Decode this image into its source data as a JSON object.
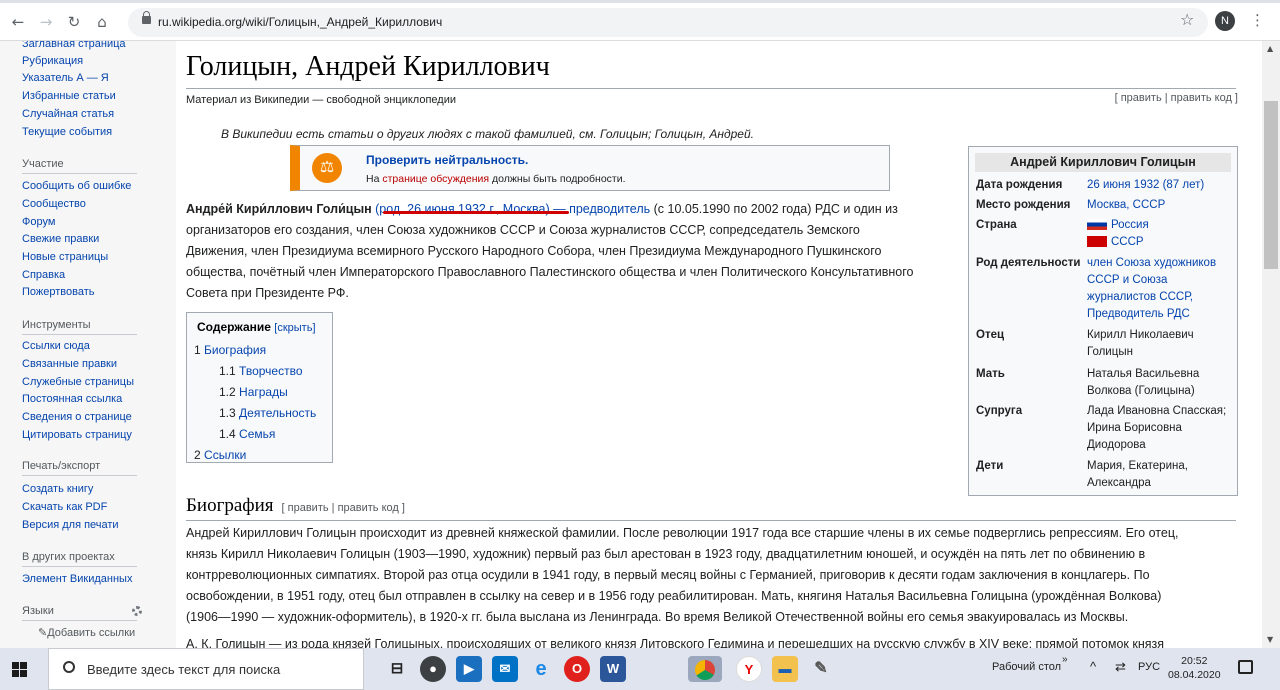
{
  "browser": {
    "url": "ru.wikipedia.org/wiki/Голицын,_Андрей_Кириллович",
    "avatar_letter": "N"
  },
  "sidebar": {
    "nav": [
      "Заглавная страница",
      "Рубрикация",
      "Указатель А — Я",
      "Избранные статьи",
      "Случайная статья",
      "Текущие события"
    ],
    "participation_header": "Участие",
    "participation": [
      "Сообщить об ошибке",
      "Сообщество",
      "Форум",
      "Свежие правки",
      "Новые страницы",
      "Справка",
      "Пожертвовать"
    ],
    "tools_header": "Инструменты",
    "tools": [
      "Ссылки сюда",
      "Связанные правки",
      "Служебные страницы",
      "Постоянная ссылка",
      "Сведения о странице",
      "Цитировать страницу"
    ],
    "print_header": "Печать/экспорт",
    "print": [
      "Создать книгу",
      "Скачать как PDF",
      "Версия для печати"
    ],
    "projects_header": "В других проектах",
    "projects": [
      "Элемент Викиданных"
    ],
    "languages_header": "Языки",
    "add_links": "✎Добавить ссылки"
  },
  "article": {
    "title": "Голицын, Андрей Кириллович",
    "subtitle": "Материал из Википедии — свободной энциклопедии",
    "edit_links": "[ править | править код ]",
    "hatnote": "В Википедии есть статьи о других людях с такой фамилией, см. Голицын; Голицын, Андрей.",
    "ambox_title": "Проверить нейтральность.",
    "ambox_text_pre": "На ",
    "ambox_text_link": "странице обсуждения",
    "ambox_text_post": " должны быть подробности.",
    "lead_line1_a": "Андре́й Кири́ллович Голи́цын",
    "lead_line1_b": " (род. 26 июня 1932 г., Москва) — ",
    "lead_line1_c": "предводитель",
    "lead_line1_d": " (с 10.05.1990 по 2002 года) РДС и один из",
    "lead_line2": "организаторов его создания, член Союза художников СССР и Союза журналистов СССР, сопредседатель Земского",
    "lead_line3": "Движения, член Президиума всемирного Русского Народного Собора, член Президиума Международного Пушкинского",
    "lead_line4": "общества, почётный член Императорского Православного Палестинского общества и член Политического Консультативного",
    "lead_line5": "Совета при Президенте РФ."
  },
  "toc": {
    "title": "Содержание",
    "toggle": "[скрыть]",
    "items": [
      {
        "num": "1",
        "label": "Биография"
      },
      {
        "num": "1.1",
        "label": "Творчество"
      },
      {
        "num": "1.2",
        "label": "Награды"
      },
      {
        "num": "1.3",
        "label": "Деятельность"
      },
      {
        "num": "1.4",
        "label": "Семья"
      },
      {
        "num": "2",
        "label": "Ссылки"
      }
    ]
  },
  "infobox": {
    "title": "Андрей Кириллович Голицын",
    "rows": [
      {
        "label": "Дата рождения",
        "value": "26 июня 1932 (87 лет)"
      },
      {
        "label": "Место рождения",
        "value": "Москва, СССР"
      },
      {
        "label": "Страна",
        "value1": "Россия",
        "value2": "СССР"
      },
      {
        "label": "Род деятельности",
        "value": "член Союза художников СССР и Союза журналистов СССР, Предводитель РДС"
      },
      {
        "label": "Отец",
        "value": "Кирилл Николаевич Голицын"
      },
      {
        "label": "Мать",
        "value": "Наталья Васильевна Волкова (Голицына)"
      },
      {
        "label": "Супруга",
        "value": "Лада Ивановна Спасская; Ирина Борисовна Диодорова"
      },
      {
        "label": "Дети",
        "value": "Мария, Екатерина, Александра"
      }
    ]
  },
  "section": {
    "title": "Биография",
    "edit": "[ править | править код ]",
    "p1_l1": "Андрей Кириллович Голицын происходит из древней княжеской фамилии. После революции 1917 года все старшие члены в их семье подверглись репрессиям. Его отец,",
    "p1_l2": "князь Кирилл Николаевич Голицын (1903—1990, художник) первый раз был арестован в 1923 году, двадцатилетним юношей, и осуждён на пять лет по обвинению в",
    "p1_l3": "контрреволюционных симпатиях. Второй раз отца осудили в 1941 году, в первый месяц войны с Германией, приговорив к десяти годам заключения в концлагерь. По",
    "p1_l4": "освобождении, в 1951 году, отец был отправлен в ссылку на север и в 1956 году реабилитирован. Мать, княгиня Наталья Васильевна Голицына (урождённая Волкова)",
    "p1_l5": "(1906—1990 — художник-оформитель), в 1920-х гг. была выслана из Ленинграда. Во время Великой Отечественной войны его семья эвакуировалась из Москвы.",
    "p2_l1": "А. К. Голицын — из рода князей Голицыных, происходящих от великого князя Литовского Гедимина и перешедших на русскую службу в XIV веке; прямой потомок князя"
  },
  "taskbar": {
    "search_placeholder": "Введите здесь текст для поиска",
    "desktop_label": "Рабочий стол",
    "lang": "РУС",
    "time": "20:52",
    "date": "08.04.2020"
  },
  "colors": {
    "link": "#0645ad",
    "ambox_accent": "#f28500",
    "underline_mark": "#d00000"
  }
}
